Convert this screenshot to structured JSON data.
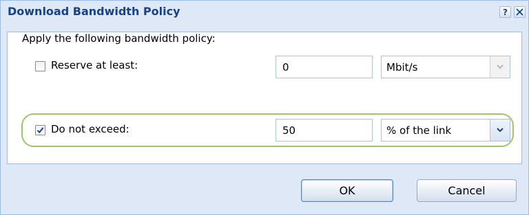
{
  "dialog": {
    "title": "Download Bandwidth Policy",
    "help_label": "?",
    "intro_text": "Apply the following bandwidth policy:"
  },
  "rows": [
    {
      "label": "Reserve at least:",
      "checked": false,
      "value": "0",
      "unit": "Mbit/s",
      "unit_enabled": false
    },
    {
      "label": "Do not exceed:",
      "checked": true,
      "value": "50",
      "unit": "% of the link",
      "unit_enabled": true
    }
  ],
  "buttons": {
    "ok_label": "OK",
    "cancel_label": "Cancel"
  },
  "colors": {
    "title_text": "#15428b",
    "highlight": "#9fc46a",
    "window_bg": "#dfe8f6"
  },
  "icons": {
    "help": "help-icon",
    "close": "close-icon",
    "checkmark": "checkmark-icon",
    "chevron": "chevron-down-icon"
  }
}
